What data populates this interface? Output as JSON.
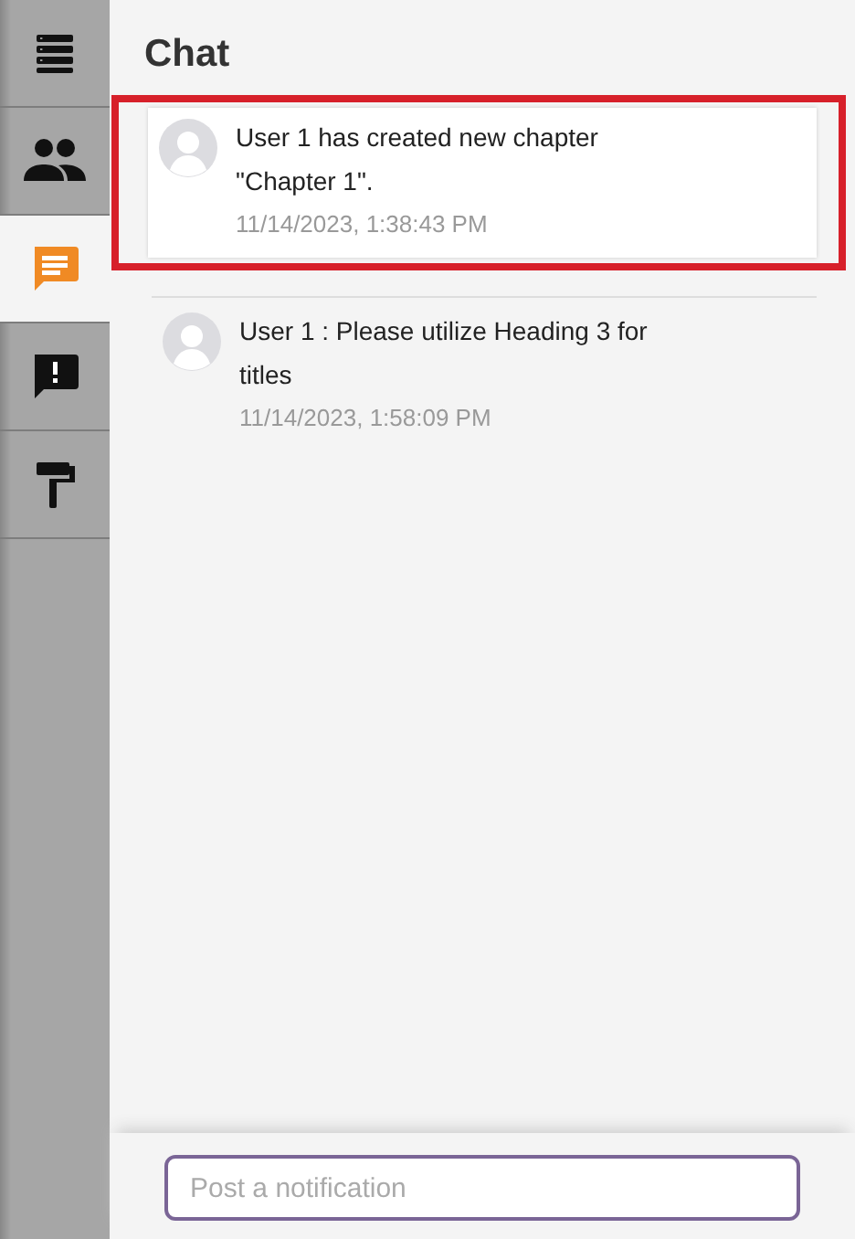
{
  "sidebar": {
    "tabs": [
      {
        "kind": "list",
        "selected": false
      },
      {
        "kind": "people",
        "selected": false
      },
      {
        "kind": "chat",
        "selected": true
      },
      {
        "kind": "alert",
        "selected": false
      },
      {
        "kind": "roller",
        "selected": false
      }
    ]
  },
  "panel": {
    "title": "Chat",
    "messages": [
      {
        "user": "User 1",
        "text": "has created new chapter \"Chapter 1\".",
        "time": "11/14/2023, 1:38:43 PM",
        "highlighted": true
      },
      {
        "user": "User 1",
        "text": ": Please utilize Heading 3 for titles",
        "time": "11/14/2023, 1:58:09 PM",
        "highlighted": false
      }
    ],
    "input": {
      "placeholder": "Post a notification"
    }
  }
}
